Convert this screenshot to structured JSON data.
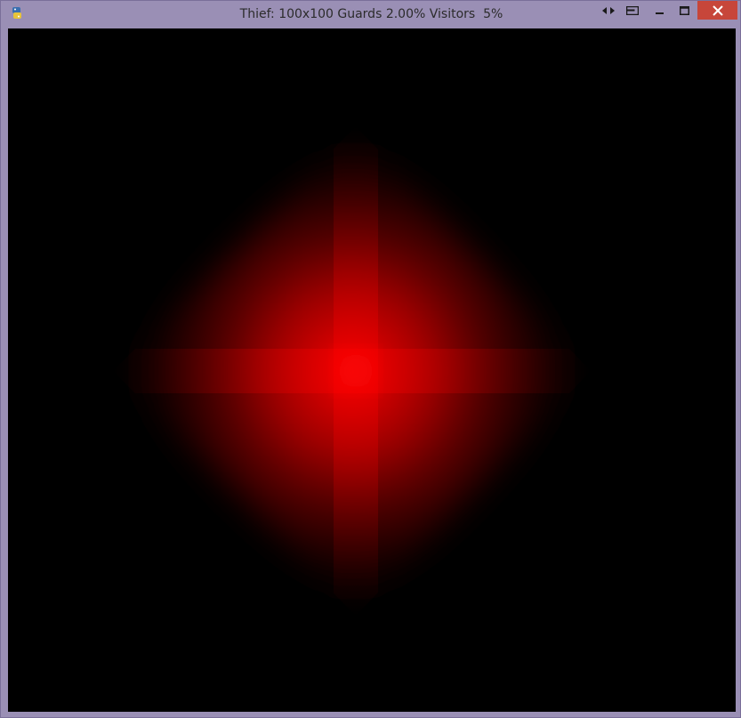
{
  "window": {
    "title": "Thief: 100x100 Guards 2.00% Visitors  5%",
    "icons": {
      "app": "python-snake-icon",
      "arrows": "resize-arrows-icon",
      "snap": "snap-layout-icon",
      "minimize": "minimize-icon",
      "maximize": "maximize-icon",
      "close": "close-icon"
    }
  },
  "grid": {
    "size": "100x100",
    "guards": "2.00%",
    "visitors": "5%"
  },
  "colors": {
    "frame": "#9a8fb5",
    "background": "#000000",
    "heat": "#ff0000",
    "close_button": "#c7463a"
  }
}
